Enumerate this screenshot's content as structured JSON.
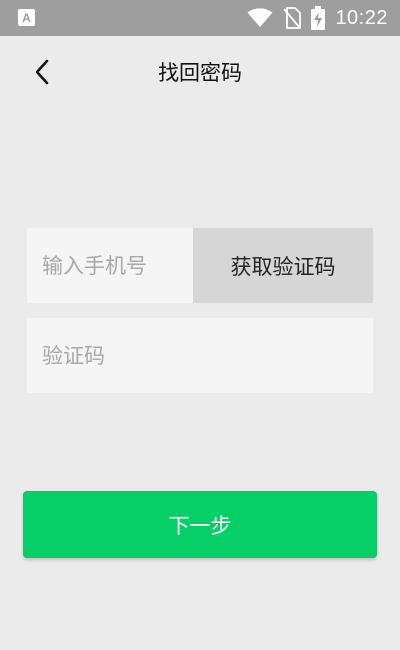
{
  "status_bar": {
    "time": "10:22",
    "icons": [
      "app-notification-icon",
      "wifi-icon",
      "no-sim-icon",
      "battery-charging-icon"
    ]
  },
  "header": {
    "title": "找回密码",
    "back_icon": "chevron-left-icon"
  },
  "form": {
    "phone_placeholder": "输入手机号",
    "phone_value": "",
    "get_code_label": "获取验证码",
    "code_placeholder": "验证码",
    "code_value": ""
  },
  "actions": {
    "next_label": "下一步"
  },
  "colors": {
    "background": "#ebebeb",
    "status_bar": "#9e9e9e",
    "input_bg": "#f5f5f5",
    "code_button_bg": "#d6d6d6",
    "primary": "#07cf67"
  }
}
